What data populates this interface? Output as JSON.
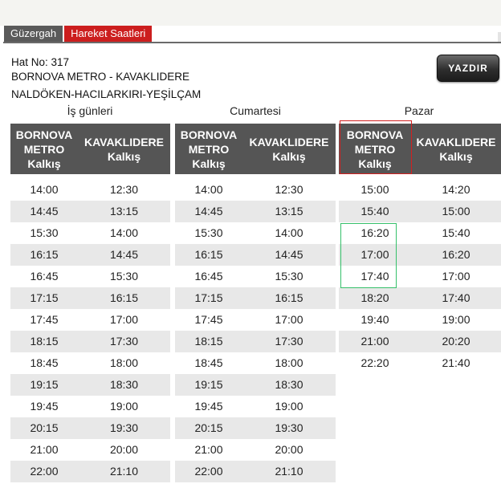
{
  "tabs": {
    "route": "Güzergah",
    "schedule": "Hareket Saatleri"
  },
  "line_no": "Hat No: 317",
  "route_name": "BORNOVA METRO - KAVAKLIDERE",
  "route_via": "NALDÖKEN-HACILARKIRI-YEŞİLÇAM",
  "print_button": "YAZDIR",
  "groups": {
    "weekdays": "İş günleri",
    "saturday": "Cumartesi",
    "sunday": "Pazar"
  },
  "headers": {
    "origin": [
      "BORNOVA",
      "METRO",
      "Kalkış"
    ],
    "destination": [
      "KAVAKLIDERE",
      "Kalkış"
    ]
  },
  "weekdays": {
    "bornova": [
      "14:00",
      "14:45",
      "15:30",
      "16:15",
      "16:45",
      "17:15",
      "17:45",
      "18:15",
      "18:45",
      "19:15",
      "19:45",
      "20:15",
      "21:00",
      "22:00"
    ],
    "kavaklidere": [
      "12:30",
      "13:15",
      "14:00",
      "14:45",
      "15:30",
      "16:15",
      "17:00",
      "17:30",
      "18:00",
      "18:30",
      "19:00",
      "19:30",
      "20:00",
      "21:10"
    ]
  },
  "saturday": {
    "bornova": [
      "14:00",
      "14:45",
      "15:30",
      "16:15",
      "16:45",
      "17:15",
      "17:45",
      "18:15",
      "18:45",
      "19:15",
      "19:45",
      "20:15",
      "21:00",
      "22:00"
    ],
    "kavaklidere": [
      "12:30",
      "13:15",
      "14:00",
      "14:45",
      "15:30",
      "16:15",
      "17:00",
      "17:30",
      "18:00",
      "18:30",
      "19:00",
      "19:30",
      "20:00",
      "21:10"
    ]
  },
  "sunday": {
    "bornova": [
      "15:00",
      "15:40",
      "16:20",
      "17:00",
      "17:40",
      "18:20",
      "19:40",
      "21:00",
      "22:20"
    ],
    "kavaklidere": [
      "14:20",
      "15:00",
      "15:40",
      "16:20",
      "17:00",
      "17:40",
      "19:00",
      "20:20",
      "21:40"
    ]
  },
  "colors": {
    "header_bg": "#555555",
    "active_tab": "#cc1e1e",
    "row_shade": "#e8e8e8",
    "highlight_red": "#d22020",
    "highlight_green": "#35c06a"
  }
}
